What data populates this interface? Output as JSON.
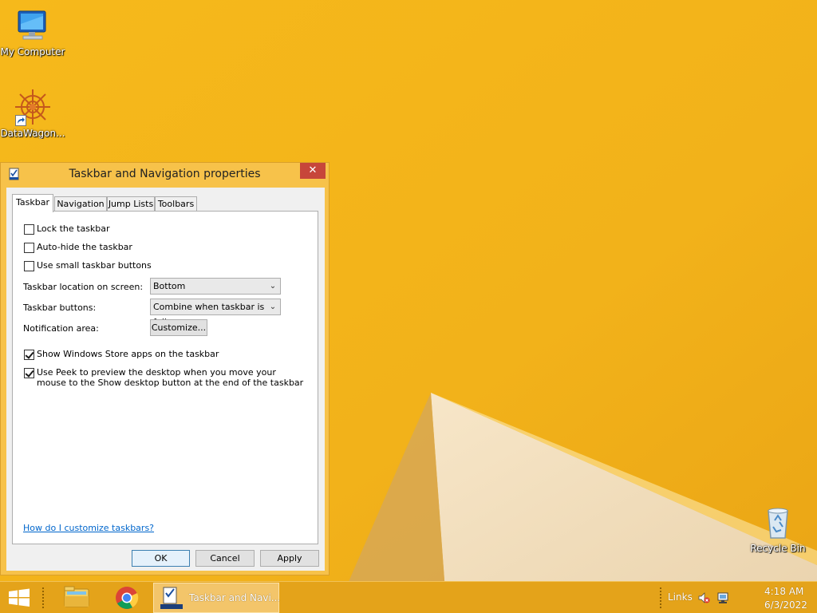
{
  "colors": {
    "wallpaper": "#f3b519",
    "accent": "#e4a31a",
    "close": "#c7463a",
    "link": "#0066cc"
  },
  "desktop": {
    "icons": [
      {
        "label": "My Computer",
        "icon": "computer-icon"
      },
      {
        "label": "DataWagon...",
        "icon": "datawagon-icon"
      },
      {
        "label": "Recycle Bin",
        "icon": "recycle-bin-icon"
      }
    ]
  },
  "dialog": {
    "title": "Taskbar and Navigation properties",
    "close_glyph": "✕",
    "tabs": [
      {
        "label": "Taskbar",
        "active": true
      },
      {
        "label": "Navigation",
        "active": false
      },
      {
        "label": "Jump Lists",
        "active": false
      },
      {
        "label": "Toolbars",
        "active": false
      }
    ],
    "checkboxes": [
      {
        "label": "Lock the taskbar",
        "checked": false
      },
      {
        "label": "Auto-hide the taskbar",
        "checked": false
      },
      {
        "label": "Use small taskbar buttons",
        "checked": false
      },
      {
        "label": "Show Windows Store apps on the taskbar",
        "checked": true
      },
      {
        "label": "Use Peek to preview the desktop when you move your mouse to the Show desktop button at the end of the taskbar",
        "checked": true
      }
    ],
    "location_label": "Taskbar location on screen:",
    "location_value": "Bottom",
    "buttons_label": "Taskbar buttons:",
    "buttons_value": "Combine when taskbar is full",
    "notification_label": "Notification area:",
    "customize_label": "Customize...",
    "help_link": "How do I customize taskbars?",
    "ok_label": "OK",
    "cancel_label": "Cancel",
    "apply_label": "Apply"
  },
  "taskbar": {
    "task_label": "Taskbar and Navi...",
    "links_label": "Links",
    "time": "4:18 AM",
    "date": "6/3/2022"
  }
}
